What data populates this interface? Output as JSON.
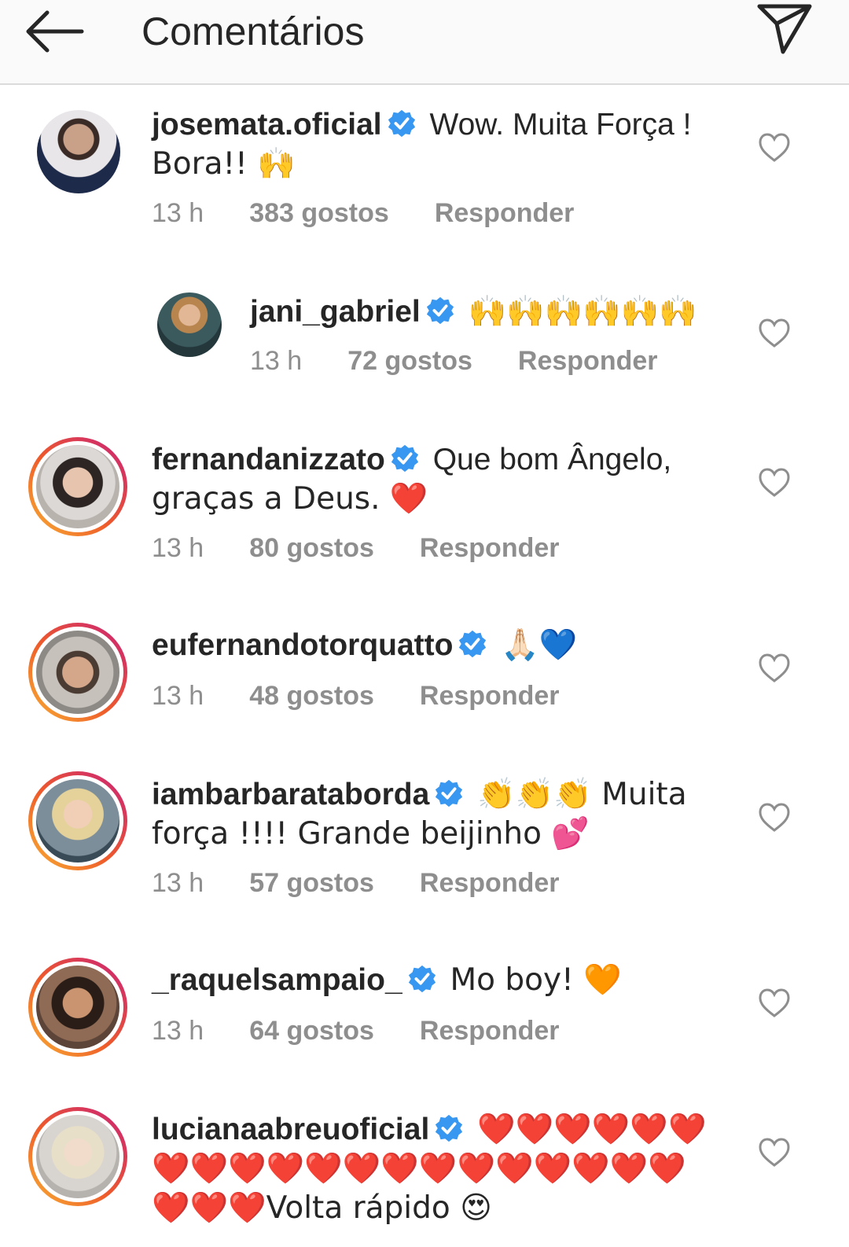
{
  "header": {
    "title": "Comentários",
    "back_icon": "arrow-left-icon",
    "send_icon": "paper-plane-icon"
  },
  "colors": {
    "verified": "#3897f0",
    "meta": "#8e8e8e",
    "text": "#262626"
  },
  "comments": [
    {
      "username": "josemata.oficial",
      "text_line1": "Wow. Muita Força !",
      "text_line2": "Bora!! 🙌",
      "time": "13 h",
      "likes": "383 gostos",
      "reply": "Responder"
    },
    {
      "username": "jani_gabriel",
      "text_line1": "🙌🙌🙌🙌🙌🙌",
      "time": "13 h",
      "likes": "72 gostos",
      "reply": "Responder"
    },
    {
      "username": "fernandanizzato",
      "text_line1": "Que bom Ângelo,",
      "text_line2": "graças a Deus. ❤️",
      "time": "13 h",
      "likes": "80 gostos",
      "reply": "Responder"
    },
    {
      "username": "eufernandotorquatto",
      "text_line1": "🙏🏻💙",
      "time": "13 h",
      "likes": "48 gostos",
      "reply": "Responder"
    },
    {
      "username": "iambarbarataborda",
      "text_line1": "👏👏👏 Muita",
      "text_line2": "força !!!! Grande beijinho 💕",
      "time": "13 h",
      "likes": "57 gostos",
      "reply": "Responder"
    },
    {
      "username": "_raquelsampaio_",
      "text_line1": "Mo boy! 🧡",
      "time": "13 h",
      "likes": "64 gostos",
      "reply": "Responder"
    },
    {
      "username": "lucianaabreuoficial",
      "text_line1": "❤️❤️❤️❤️❤️❤️",
      "text_line2": "❤️❤️❤️❤️❤️❤️❤️❤️❤️❤️❤️❤️❤️❤️",
      "text_line3": "❤️❤️❤️Volta rápido 😍"
    }
  ]
}
